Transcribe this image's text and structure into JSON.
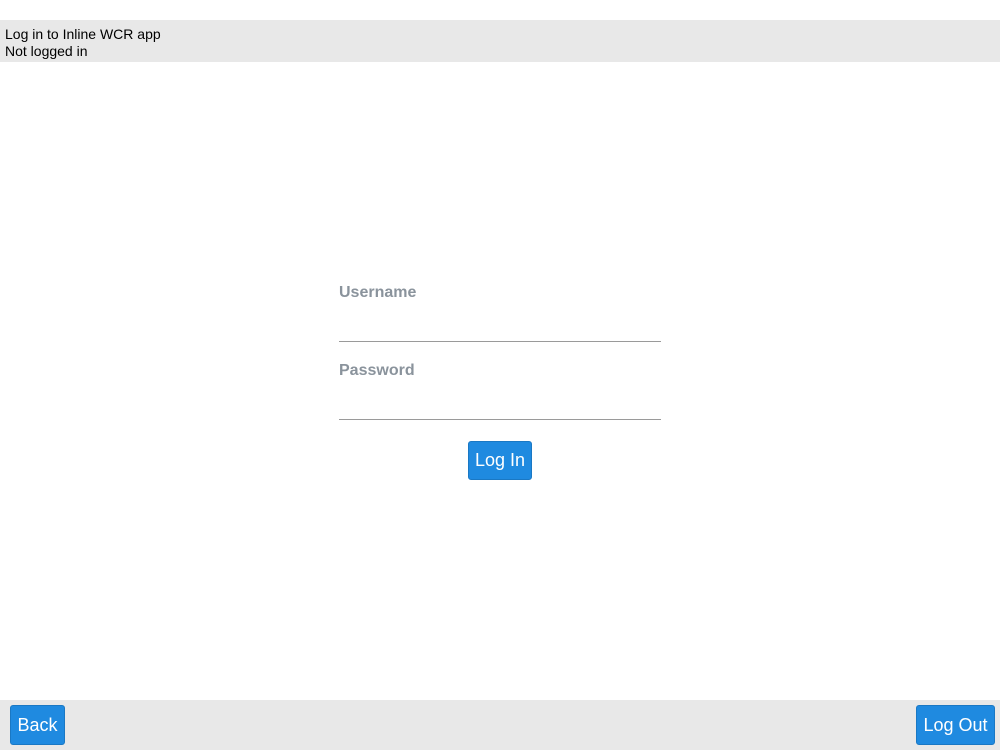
{
  "header": {
    "title": "Log in to Inline WCR app",
    "status": "Not logged in"
  },
  "form": {
    "username_label": "Username",
    "username_value": "",
    "password_label": "Password",
    "password_value": "",
    "login_label": "Log In"
  },
  "footer": {
    "back_label": "Back",
    "logout_label": "Log Out"
  },
  "colors": {
    "accent": "#1f8ae0",
    "bar_background": "#e8e8e8",
    "label_gray": "#8a939c"
  }
}
